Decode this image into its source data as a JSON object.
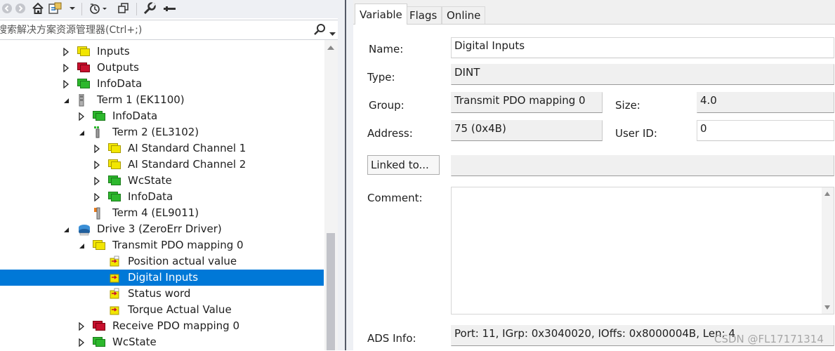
{
  "search": {
    "placeholder": "搜索解决方案资源管理器(Ctrl+;)"
  },
  "tree": [
    {
      "label": "Inputs",
      "icon": "inputs-folder-icon",
      "expander": "closed"
    },
    {
      "label": "Outputs",
      "icon": "outputs-folder-icon",
      "expander": "closed"
    },
    {
      "label": "InfoData",
      "icon": "infodata-folder-icon",
      "expander": "closed"
    },
    {
      "label": "Term 1 (EK1100)",
      "icon": "terminal-coupler-icon",
      "expander": "open"
    },
    {
      "label": "InfoData",
      "icon": "infodata-folder-icon",
      "expander": "closed"
    },
    {
      "label": "Term 2 (EL3102)",
      "icon": "terminal-analog-icon",
      "expander": "open"
    },
    {
      "label": "AI Standard Channel 1",
      "icon": "channel-folder-icon",
      "expander": "closed"
    },
    {
      "label": "AI Standard Channel 2",
      "icon": "channel-folder-icon",
      "expander": "closed"
    },
    {
      "label": "WcState",
      "icon": "wcstate-folder-icon",
      "expander": "closed"
    },
    {
      "label": "InfoData",
      "icon": "infodata-folder-icon",
      "expander": "closed"
    },
    {
      "label": "Term 4 (EL9011)",
      "icon": "terminal-end-icon",
      "expander": "none"
    },
    {
      "label": "Drive 3 (ZeroErr Driver)",
      "icon": "drive-icon",
      "expander": "open"
    },
    {
      "label": "Transmit PDO mapping 0",
      "icon": "pdo-folder-icon",
      "expander": "open"
    },
    {
      "label": "Position actual value",
      "icon": "variable-input-icon",
      "expander": "none"
    },
    {
      "label": "Digital Inputs",
      "icon": "variable-input-linked-icon",
      "expander": "none",
      "selected": true
    },
    {
      "label": "Status word",
      "icon": "variable-input-icon",
      "expander": "none"
    },
    {
      "label": "Torque Actual Value",
      "icon": "variable-input-linked-icon",
      "expander": "none"
    },
    {
      "label": "Receive PDO mapping 0",
      "icon": "outputs-folder-icon",
      "expander": "closed"
    },
    {
      "label": "WcState",
      "icon": "wcstate-folder-icon",
      "expander": "closed"
    }
  ],
  "tabs": [
    "Variable",
    "Flags",
    "Online"
  ],
  "form": {
    "name_label": "Name:",
    "name_value": "Digital Inputs",
    "type_label": "Type:",
    "type_value": "DINT",
    "group_label": "Group:",
    "group_value": "Transmit PDO mapping 0",
    "size_label": "Size:",
    "size_value": "4.0",
    "address_label": "Address:",
    "address_value": "75 (0x4B)",
    "userid_label": "User ID:",
    "userid_value": "0",
    "linked_button": "Linked to...",
    "linked_value": "",
    "comment_label": "Comment:",
    "comment_value": "",
    "ads_label": "ADS Info:",
    "ads_value": "Port: 11, IGrp: 0x3040020, IOffs: 0x8000004B, Len: 4"
  },
  "watermark": "CSDN @FL17171314",
  "colors": {
    "selection": "#0078d7",
    "folder_yellow": "#f2e600",
    "folder_red": "#c8102e",
    "folder_green": "#2db82d"
  }
}
